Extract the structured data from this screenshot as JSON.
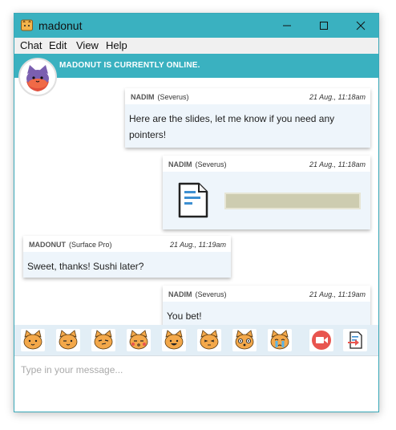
{
  "window": {
    "title": "madonut"
  },
  "menu": [
    "Chat",
    "Edit",
    "View",
    "Help"
  ],
  "banner": {
    "status": "MADONUT IS CURRENTLY ONLINE.",
    "avatar_icon": "cat-avatar-icon"
  },
  "messages": [
    {
      "sender": "NADIM",
      "device": "(Severus)",
      "time": "21 Aug., 11:18am",
      "text": [
        "Here are the slides, let me know if you need any",
        "pointers!"
      ]
    },
    {
      "sender": "NADIM",
      "device": "(Severus)",
      "time": "21 Aug., 11:18am",
      "attachment_icon": "document-file-icon"
    },
    {
      "sender": "MADONUT",
      "device": "(Surface Pro)",
      "time": "21 Aug., 11:19am",
      "text": [
        "Sweet, thanks! Sushi later?"
      ]
    },
    {
      "sender": "NADIM",
      "device": "(Severus)",
      "time": "21 Aug., 11:19am",
      "text": [
        "You bet!"
      ]
    }
  ],
  "emoji_bar": {
    "emojis": [
      "cat-smile-icon",
      "cat-wink-icon",
      "cat-smirk-icon",
      "cat-kiss-icon",
      "cat-grin-icon",
      "cat-squint-icon",
      "cat-surprised-icon",
      "cat-crying-icon"
    ],
    "video_icon": "video-call-icon",
    "send_file_icon": "send-file-icon"
  },
  "composer": {
    "placeholder": "Type in your message..."
  },
  "colors": {
    "accent": "#3ab1c0",
    "bubble": "#eef5fb",
    "emoji_bar": "#e2eef6",
    "video_button": "#e8554f"
  }
}
